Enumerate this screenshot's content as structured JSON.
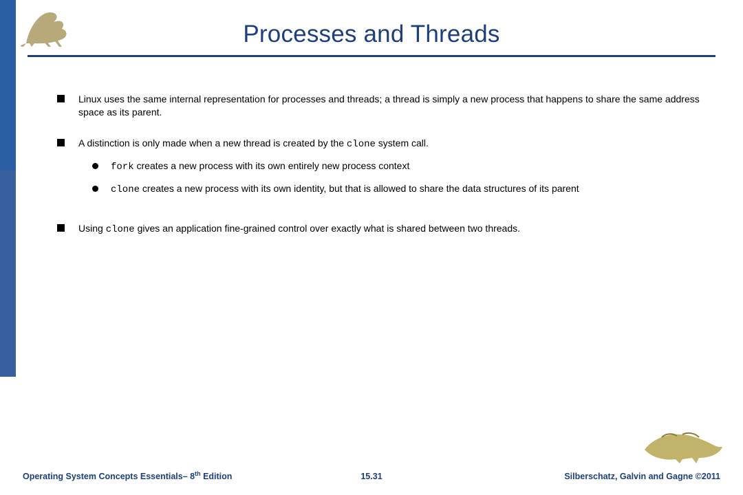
{
  "title": "Processes and Threads",
  "bullets": {
    "b1": "Linux uses the same internal representation for processes and threads; a thread is simply a new process that happens to share the same address space as its parent.",
    "b2_pre": "A distinction is only made when a new thread is created by the ",
    "b2_code": "clone",
    "b2_post": " system call.",
    "s1_code": "fork",
    "s1_post": " creates a new process with its own entirely new process context",
    "s2_code": "clone",
    "s2_post": " creates a new process with its own identity, but that is allowed to share the data structures of its parent",
    "b3_pre": "Using ",
    "b3_code": "clone",
    "b3_post": " gives an application fine-grained control over exactly what is shared between two threads."
  },
  "footer": {
    "left_pre": "Operating System Concepts Essentials– 8",
    "left_sup": "th",
    "left_post": " Edition",
    "center": "15.31",
    "right": "Silberschatz, Galvin and Gagne ©2011"
  },
  "icons": {
    "dino_top": "dinosaur-top-icon",
    "dino_bottom": "dinosaur-bottom-icon"
  }
}
